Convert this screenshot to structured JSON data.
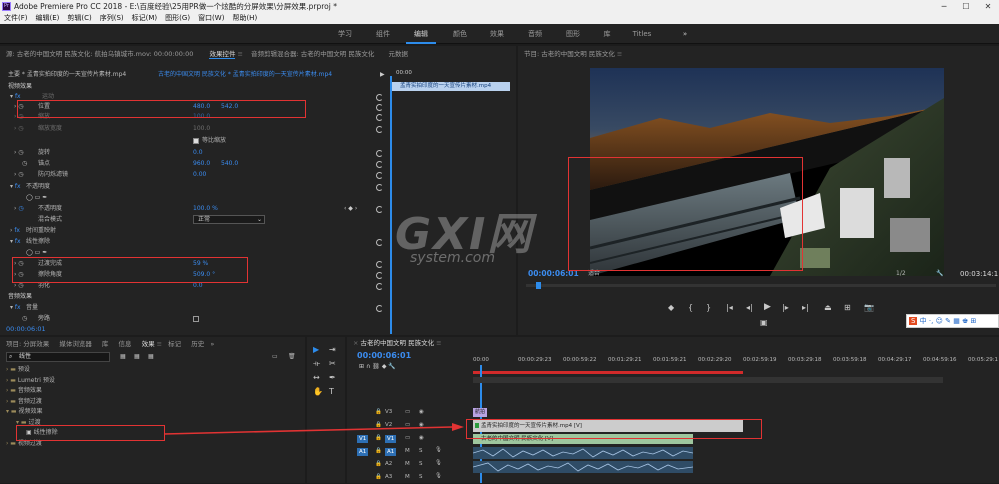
{
  "window": {
    "title": "Adobe Premiere Pro CC 2018 - E:\\百度经验\\25用PR做一个炫酷的分屏效果\\分屏效果.prproj *",
    "app_icon": "Pr"
  },
  "menu": [
    "文件(F)",
    "编辑(E)",
    "剪辑(C)",
    "序列(S)",
    "标记(M)",
    "图形(G)",
    "窗口(W)",
    "帮助(H)"
  ],
  "workspaces": [
    "学习",
    "组件",
    "编辑",
    "颜色",
    "效果",
    "音频",
    "图形",
    "库",
    "Titles"
  ],
  "source_panel": {
    "tabs": [
      "源: 古老的中国文明 民族文化: 航拍乌镇城市.mov: 00:00:00:00",
      "效果控件",
      "音频剪辑混合器: 古老的中国文明 民族文化",
      "元数据"
    ],
    "clip_path": "主要 * 孟青实拍印度的一天宣传片素材.mp4",
    "sequence_path": "古老的中国文明 民族文化 * 孟青实拍印度的一天宣传片素材.mp4",
    "mini_timecode": "00:00",
    "mini_clip": "孟青实拍印度的一天宣传片素材.mp4",
    "section_video": "视频效果",
    "motion": "运动",
    "position": {
      "label": "位置",
      "x": "480.0",
      "y": "542.0"
    },
    "scale": {
      "label": "缩放",
      "value": "100.0"
    },
    "scale_width": {
      "label": "缩放宽度",
      "value": "100.0"
    },
    "uniform_scale": "等比缩放",
    "rotation": {
      "label": "旋转",
      "value": "0.0"
    },
    "anchor": {
      "label": "锚点",
      "x": "960.0",
      "y": "540.0"
    },
    "anti_flicker": {
      "label": "防闪烁滤镜",
      "value": "0.00"
    },
    "opacity_fx": "不透明度",
    "opacity": {
      "label": "不透明度",
      "value": "100.0 %"
    },
    "blend": {
      "label": "混合模式",
      "value": "正常"
    },
    "time_remap": "时间重映射",
    "linear_wipe": "线性擦除",
    "transition_completion": {
      "label": "过渡完成",
      "value": "59 %"
    },
    "wipe_angle": {
      "label": "擦除角度",
      "value": "509.0 °"
    },
    "feather": {
      "label": "羽化",
      "value": "0.0"
    },
    "section_audio": "音频效果",
    "volume": "音量",
    "bypass": "旁路",
    "timecode": "00:00:06:01"
  },
  "program_monitor": {
    "title": "节目: 古老的中国文明 民族文化",
    "timecode": "00:00:06:01",
    "fit": "适合",
    "ratio": "1/2",
    "duration": "00:03:14:1"
  },
  "project_panel": {
    "tabs": [
      "项目: 分屏效果",
      "媒体浏览器",
      "库",
      "信息",
      "效果",
      "标记",
      "历史"
    ],
    "search_value": "线性",
    "tree": [
      {
        "label": "预设",
        "indent": 0
      },
      {
        "label": "Lumetri 预设",
        "indent": 0
      },
      {
        "label": "音频效果",
        "indent": 0
      },
      {
        "label": "音频过渡",
        "indent": 0
      },
      {
        "label": "视频效果",
        "indent": 0
      },
      {
        "label": "过渡",
        "indent": 1
      },
      {
        "label": "线性擦除",
        "indent": 2
      },
      {
        "label": "视频过渡",
        "indent": 0
      }
    ]
  },
  "timeline": {
    "title": "古老的中国文明 民族文化",
    "timecode": "00:00:06:01",
    "ruler": [
      "00:00",
      "00:00:29:23",
      "00:00:59:22",
      "00:01:29:21",
      "00:01:59:21",
      "00:02:29:20",
      "00:02:59:19",
      "00:03:29:18",
      "00:03:59:18",
      "00:04:29:17",
      "00:04:59:16",
      "00:05:29:1"
    ],
    "tracks": [
      {
        "name": "V3"
      },
      {
        "name": "V2"
      },
      {
        "name": "V1",
        "src": "V1"
      },
      {
        "name": "A1",
        "src": "A1"
      },
      {
        "name": "A2"
      },
      {
        "name": "A3"
      }
    ],
    "clips": {
      "v3": "航拍",
      "v2": "孟青实拍印度的一天宣传片素材.mp4 [V]",
      "v1": "古老的中国文明 民族文化 [V]"
    }
  },
  "watermark": {
    "brand": "GXI网",
    "sub": "system.com"
  },
  "colors": {
    "accent": "#2d8ceb",
    "highlight": "#e23333",
    "clip_green": "#9ec69e",
    "clip_purple": "#b9a3e3",
    "clip_gray": "#cccccc"
  }
}
